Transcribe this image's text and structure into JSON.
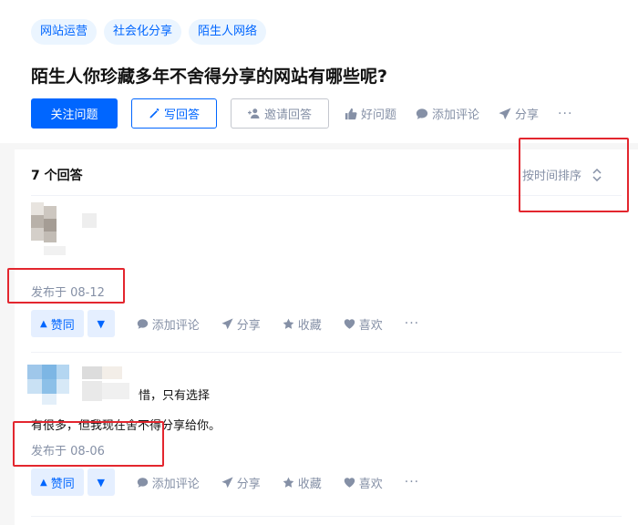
{
  "question": {
    "topics": [
      "网站运营",
      "社会化分享",
      "陌生人网络"
    ],
    "title": "陌生人你珍藏多年不舍得分享的网站有哪些呢?",
    "follow_label": "关注问题",
    "write_label": "写回答",
    "invite_label": "邀请回答",
    "good_label": "好问题",
    "comment_label": "添加评论",
    "share_label": "分享",
    "more_label": "···"
  },
  "answers_header": {
    "count_label": "7 个回答",
    "sort_label": "按时间排序"
  },
  "answers": [
    {
      "text": "",
      "content": "",
      "date": "发布于 08-12",
      "upvote_label": "赞同",
      "comment_label": "添加评论",
      "share_label": "分享",
      "collect_label": "收藏",
      "like_label": "喜欢",
      "more_label": "···"
    },
    {
      "text": "惜，只有选择",
      "content": "有很多，但我现在舍不得分享给你。",
      "date": "发布于 08-06",
      "upvote_label": "赞同",
      "comment_label": "添加评论",
      "share_label": "分享",
      "collect_label": "收藏",
      "like_label": "喜欢",
      "more_label": "···"
    }
  ],
  "colors": {
    "brand": "#0066ff",
    "annotation": "#e3262e",
    "muted": "#8590a6"
  }
}
